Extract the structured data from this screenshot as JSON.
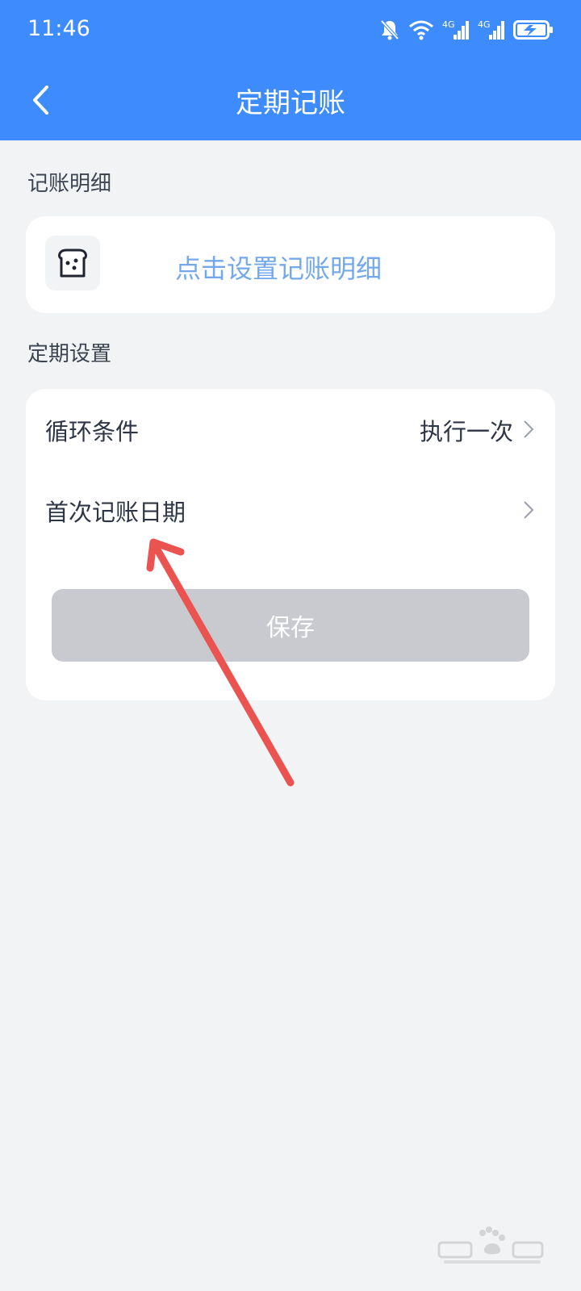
{
  "status_bar": {
    "time": "11:46",
    "icons": [
      "bell-muted-icon",
      "wifi-icon",
      "signal-4g-icon",
      "signal-4g-icon",
      "battery-charging-icon"
    ],
    "signal_label_1": "4G",
    "signal_label_2": "4G"
  },
  "header": {
    "title": "定期记账",
    "back_icon": "chevron-left-icon"
  },
  "detail_section": {
    "label": "记账明细",
    "icon": "bread-icon",
    "link": "点击设置记账明细"
  },
  "schedule_section": {
    "label": "定期设置",
    "rows": [
      {
        "label": "循环条件",
        "value": "执行一次"
      },
      {
        "label": "首次记账日期",
        "value": ""
      }
    ],
    "save_label": "保存"
  },
  "colors": {
    "header_bg": "#3d8bfd",
    "page_bg": "#f2f3f5",
    "link": "#74a8ec",
    "save_disabled": "#c8cad0",
    "annotation_arrow": "#ea5350"
  },
  "annotation": {
    "type": "arrow",
    "icon": "red-arrow-annotation"
  },
  "watermark": {
    "icon": "baidu-jingyan-logo"
  }
}
